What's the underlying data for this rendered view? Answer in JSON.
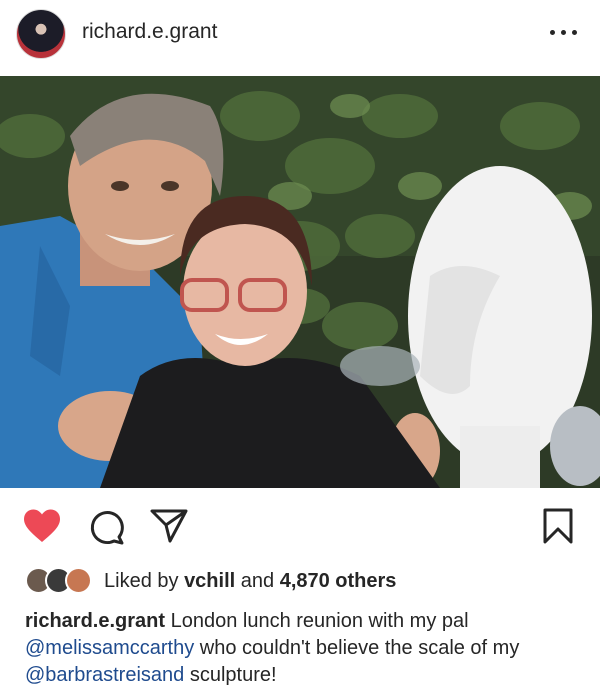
{
  "header": {
    "username": "richard.e.grant"
  },
  "post": {
    "liked_by_label": "Liked by",
    "liked_by_user": "vchill",
    "and_label": "and",
    "others_count": "4,870 others",
    "caption": {
      "username": "richard.e.grant",
      "text_1": "London lunch reunion with my pal",
      "mention_1": "@melissamccarthy",
      "text_2": "who couldn't believe the scale of my",
      "mention_2": "@barbrastreisand",
      "text_3": "sculpture!"
    }
  },
  "icons": {
    "more": "more-options-icon",
    "like": "heart-icon",
    "comment": "comment-icon",
    "share": "share-icon",
    "save": "bookmark-icon"
  },
  "colors": {
    "like_active": "#ed4956",
    "mention": "#1f4b8e",
    "text": "#262626"
  }
}
